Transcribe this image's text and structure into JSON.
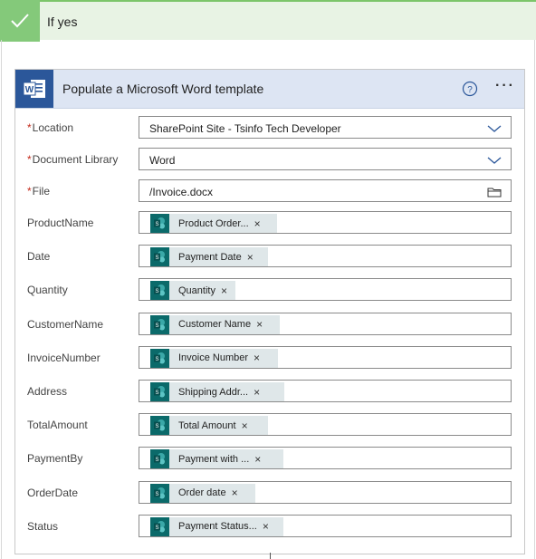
{
  "branch": {
    "label": "If yes",
    "icon": "checkmark-icon"
  },
  "action": {
    "title": "Populate a Microsoft Word template",
    "icon": "word-icon",
    "help_icon": "help-icon",
    "more_label": "···",
    "brand_color": "#2b579a"
  },
  "fields": {
    "location": {
      "label": "Location",
      "required": "*",
      "value": "SharePoint Site - Tsinfo Tech Developer"
    },
    "document_library": {
      "label": "Document Library",
      "required": "*",
      "value": "Word"
    },
    "file": {
      "label": "File",
      "required": "*",
      "value": "/Invoice.docx"
    }
  },
  "token_fields": [
    {
      "label": "ProductName",
      "token": "Product Order..."
    },
    {
      "label": "Date",
      "token": "Payment Date"
    },
    {
      "label": "Quantity",
      "token": "Quantity"
    },
    {
      "label": "CustomerName",
      "token": "Customer Name"
    },
    {
      "label": "InvoiceNumber",
      "token": "Invoice Number"
    },
    {
      "label": "Address",
      "token": "Shipping Addr..."
    },
    {
      "label": "TotalAmount",
      "token": "Total Amount"
    },
    {
      "label": "PaymentBy",
      "token": "Payment with ..."
    },
    {
      "label": "OrderDate",
      "token": "Order date"
    },
    {
      "label": "Status",
      "token": "Payment Status..."
    }
  ],
  "token_remove_glyph": "×",
  "token_icon": "sharepoint-icon"
}
